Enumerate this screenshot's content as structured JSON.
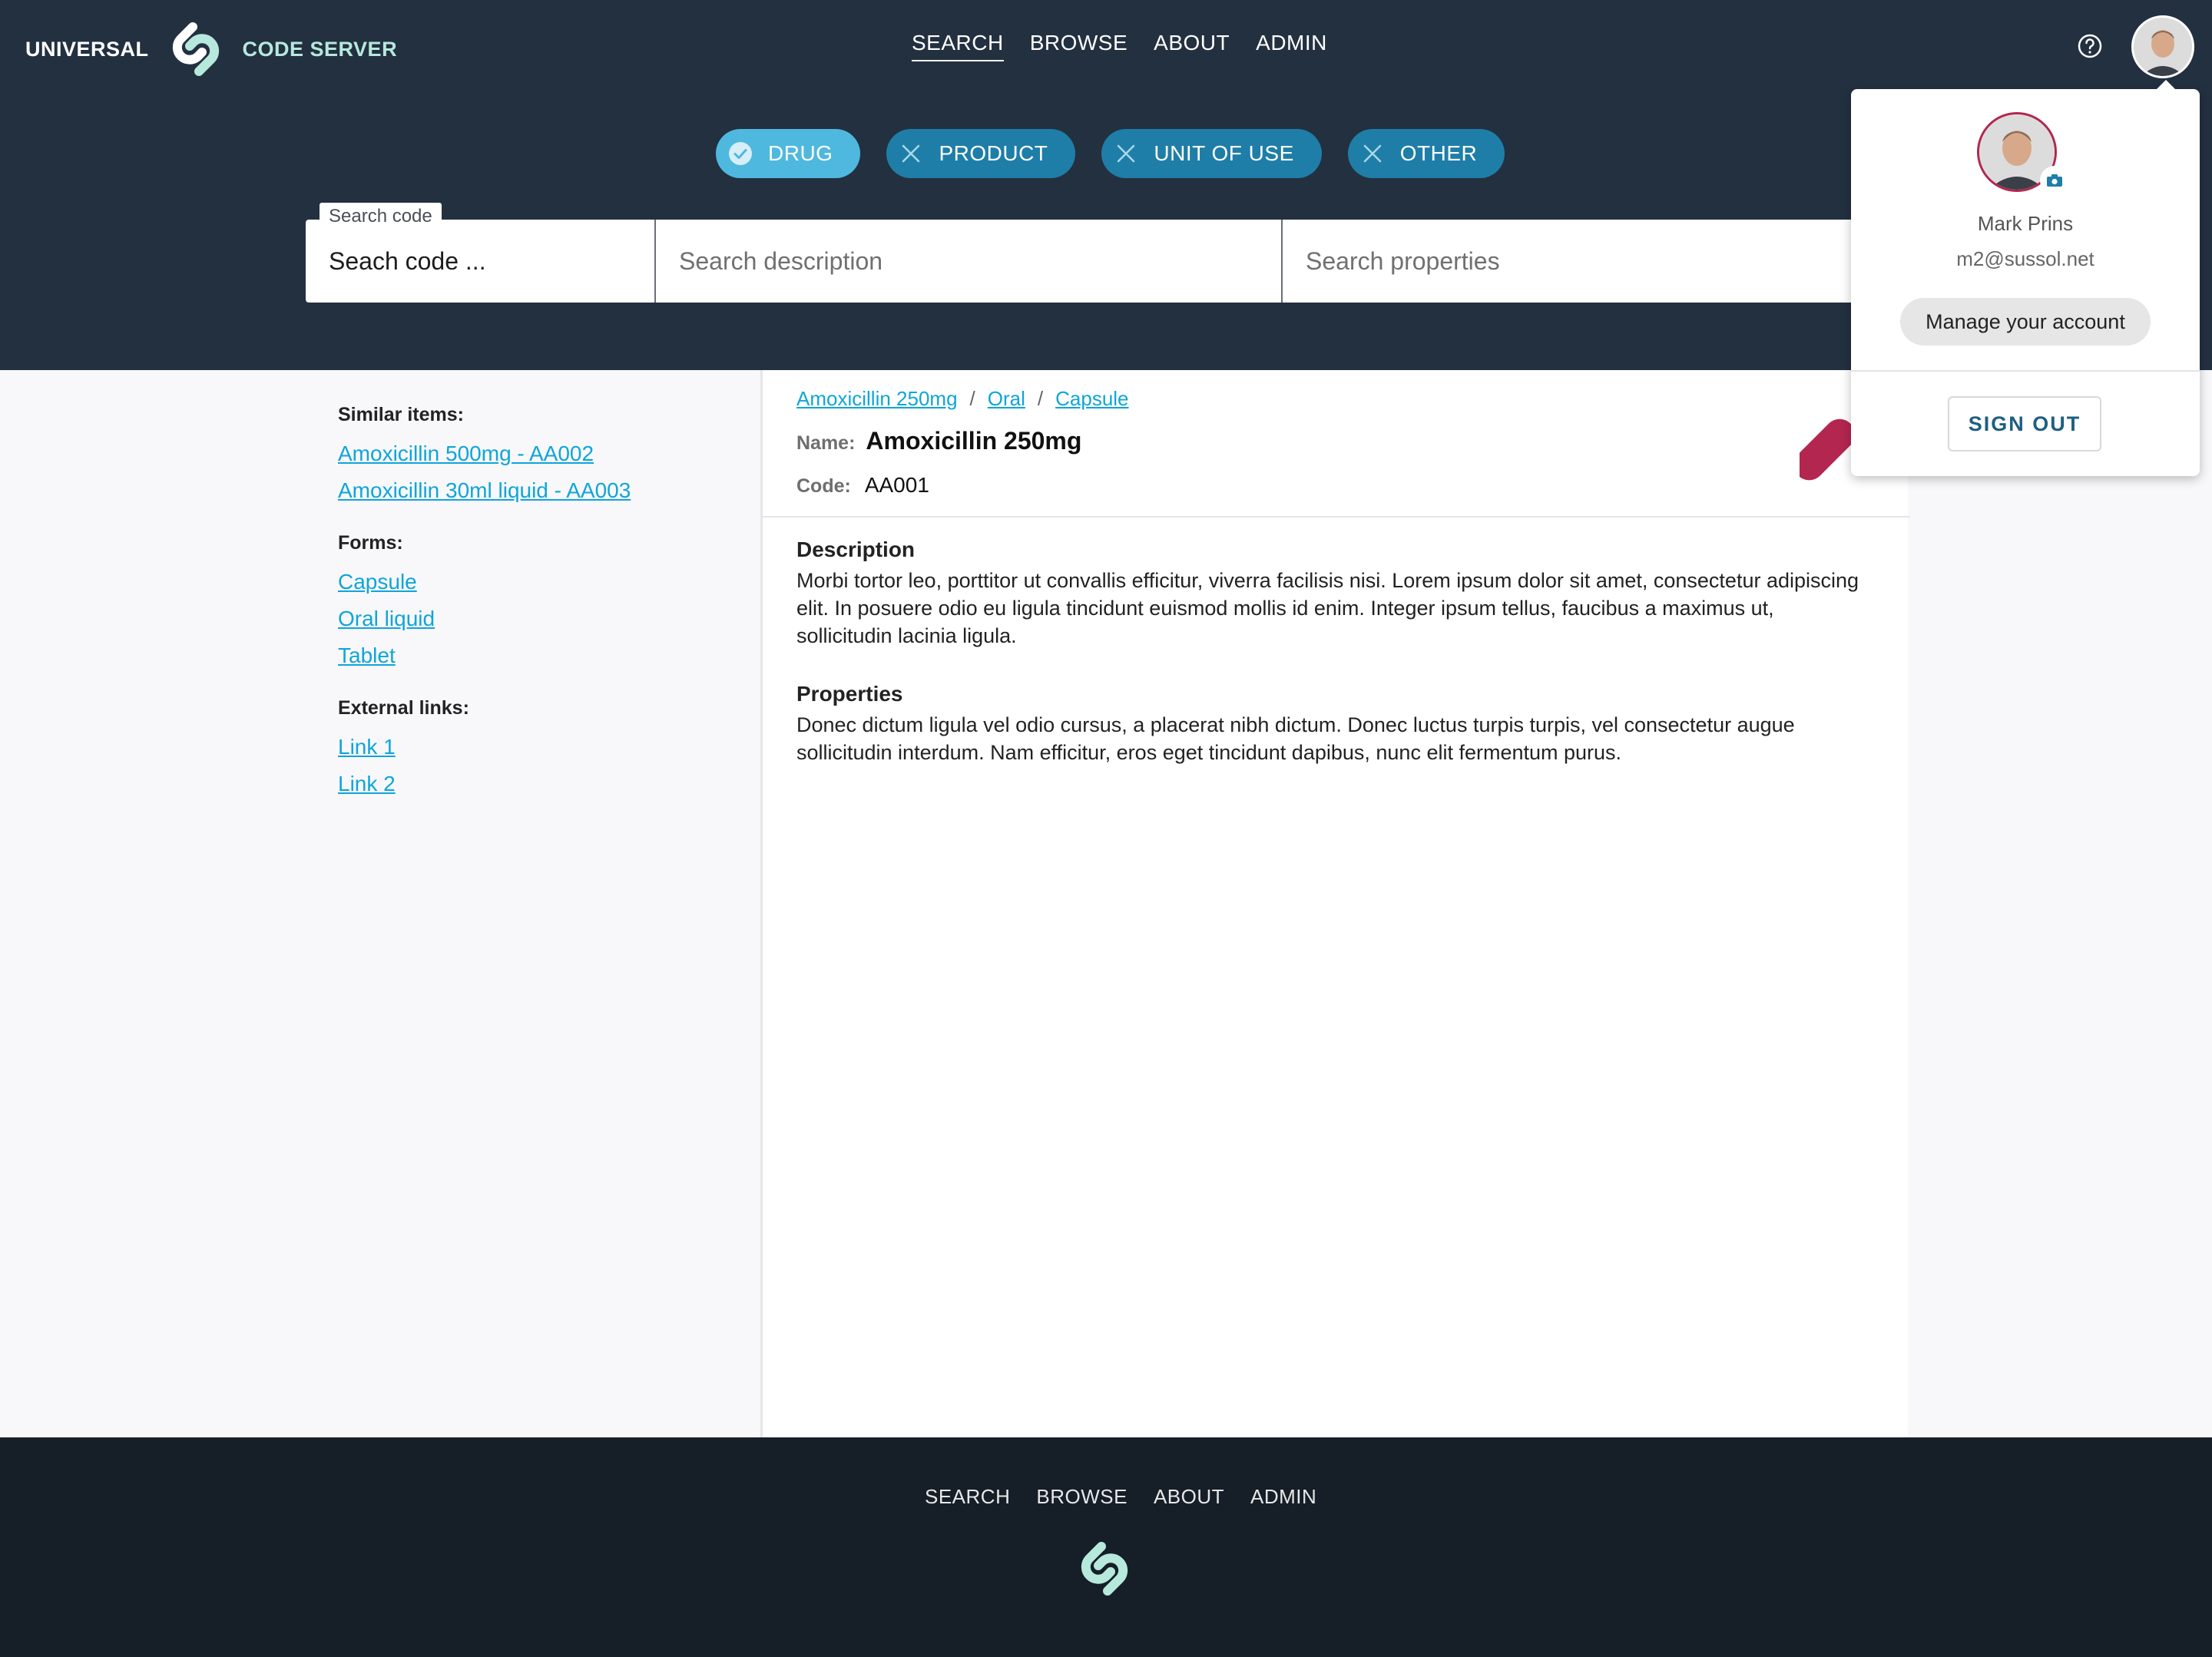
{
  "header": {
    "logo": {
      "left_text": "UNIVERSAL",
      "right_text": "CODE SERVER",
      "icon": "link-logo-icon"
    },
    "nav": [
      "SEARCH",
      "BROWSE",
      "ABOUT",
      "ADMIN"
    ],
    "active_nav": "SEARCH",
    "help_icon": "help-circle-icon",
    "avatar_icon": "user-avatar"
  },
  "filters": [
    {
      "label": "DRUG",
      "selected": true,
      "icon": "check-circle-icon"
    },
    {
      "label": "PRODUCT",
      "selected": false,
      "icon": "close-icon"
    },
    {
      "label": "UNIT OF USE",
      "selected": false,
      "icon": "close-icon"
    },
    {
      "label": "OTHER",
      "selected": false,
      "icon": "close-icon"
    }
  ],
  "search": {
    "code_label": "Search code",
    "code_placeholder": "Seach code ...",
    "description_placeholder": "Search description",
    "properties_placeholder": "Search properties"
  },
  "sidebar": {
    "similar_title": "Similar items:",
    "similar": [
      "Amoxicillin 500mg - AA002",
      "Amoxicillin 30ml liquid - AA003"
    ],
    "forms_title": "Forms:",
    "forms": [
      "Capsule",
      "Oral liquid",
      "Tablet"
    ],
    "external_title": "External links:",
    "external": [
      "Link 1",
      "Link 2"
    ]
  },
  "detail": {
    "breadcrumb": [
      "Amoxicillin 250mg",
      "Oral",
      "Capsule"
    ],
    "breadcrumb_sep": "/",
    "name_label": "Name:",
    "name": "Amoxicillin 250mg",
    "code_label": "Code:",
    "code": "AA001",
    "description_title": "Description",
    "description": "Morbi tortor leo, porttitor ut convallis efficitur, viverra facilisis nisi. Lorem ipsum dolor sit amet, consectetur adipiscing elit. In posuere odio eu ligula tincidunt euismod mollis id enim. Integer ipsum tellus, faucibus a maximus ut, sollicitudin lacinia ligula.",
    "properties_title": "Properties",
    "properties": "Donec dictum ligula vel odio cursus, a placerat nibh dictum. Donec luctus turpis turpis, vel consectetur augue sollicitudin interdum. Nam efficitur, eros eget tincidunt dapibus, nunc elit fermentum purus.",
    "form_icon": "capsule-icon"
  },
  "account": {
    "name": "Mark Prins",
    "email": "m2@sussol.net",
    "manage_label": "Manage your account",
    "signout_label": "SIGN OUT",
    "camera_icon": "camera-icon"
  },
  "footer": {
    "nav": [
      "SEARCH",
      "BROWSE",
      "ABOUT",
      "ADMIN"
    ],
    "logo_icon": "link-logo-icon"
  },
  "colors": {
    "header_bg": "#233040",
    "footer_bg": "#161e28",
    "chip": "#1e7ea7",
    "chip_selected": "#4fb8df",
    "link": "#0fa5d9",
    "accent_mint": "#b6e9dc",
    "capsule": "#b3264f"
  }
}
